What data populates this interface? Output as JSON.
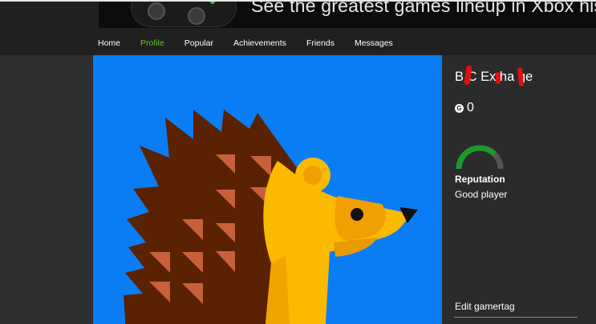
{
  "banner": {
    "tagline": "See the greatest games lineup in Xbox history."
  },
  "nav": {
    "items": [
      {
        "label": "Home",
        "active": false
      },
      {
        "label": "Profile",
        "active": true
      },
      {
        "label": "Popular",
        "active": false
      },
      {
        "label": "Achievements",
        "active": false
      },
      {
        "label": "Friends",
        "active": false
      },
      {
        "label": "Messages",
        "active": false
      }
    ]
  },
  "profile": {
    "gamertag": "B  C Ex ha  ge",
    "gamerscore_icon": "G",
    "gamerscore": "0",
    "reputation_label": "Reputation",
    "reputation_value": "Good player",
    "reputation_level": 0.75,
    "edit_link": "Edit gamertag"
  },
  "colors": {
    "accent_green": "#5fc31c",
    "avatar_bg": "#0a7df4",
    "redaction": "#e01010"
  }
}
